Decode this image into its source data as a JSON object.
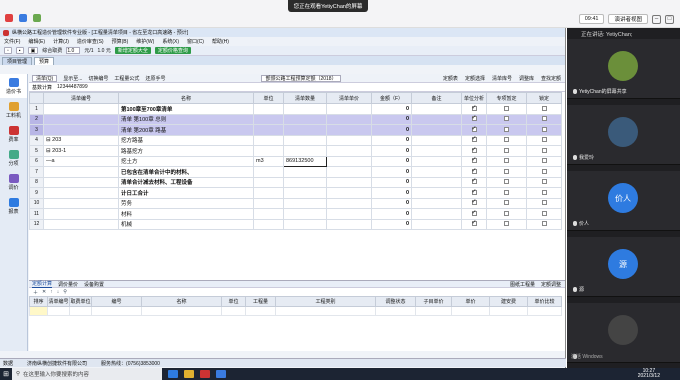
{
  "meeting": {
    "share_banner": "您正在观看YetiyChan的屏幕",
    "time": "09:41",
    "view_label": "演讲者视图"
  },
  "app": {
    "title": "纵横公路工程造价管理软件专业版 - [工程量清单项目 - 省左至龙口高速路 - 预计]",
    "menu": [
      "文件(F)",
      "编辑(E)",
      "计算(J)",
      "造价审查(S)",
      "预算(B)",
      "维护(W)",
      "系统(X)",
      "窗口(C)",
      "帮助(H)"
    ],
    "toolbar": {
      "rate_label": "综合取费",
      "rate_value": "1.0",
      "unit_price_label": "元/1",
      "price2_label": "1.0 元",
      "green_btn1": "新增定额大全",
      "green_btn2": "定额价格查询"
    },
    "project_tab": "项目管理",
    "project_subtab": "预算",
    "sidebar": [
      "造价书",
      "工料机",
      "费率",
      "分项",
      "调价",
      "报表"
    ],
    "filter": {
      "items": [
        "清单(Q)",
        "显示至...",
        "切换编号",
        "工程量公式",
        "还原手号"
      ],
      "standard": "部颁公路工程预算定额（2018）",
      "right_items": [
        "定额表",
        "定额选择",
        "清单库号",
        "调整库",
        "查找定额"
      ]
    },
    "input_bar": {
      "label": "基数计算",
      "value": "12344487899"
    },
    "grid": {
      "headers": [
        "",
        "清单编号",
        "名称",
        "单位",
        "清单数量",
        "清单单价",
        "金额（F）",
        "备注",
        "单位分析",
        "专项暂定",
        "锁定"
      ],
      "rows": [
        {
          "n": "1",
          "code": "",
          "name": "第100章至700章清单",
          "unit": "",
          "qty": "",
          "price": "",
          "amount": "0",
          "note": "",
          "sel": false,
          "bold": true,
          "chk1": true,
          "chk2": false,
          "chk3": false
        },
        {
          "n": "2",
          "code": "",
          "name": "清单  第100章  总则",
          "unit": "",
          "qty": "",
          "price": "",
          "amount": "0",
          "note": "",
          "sel": true,
          "bold": false,
          "chk1": true,
          "chk2": false,
          "chk3": false
        },
        {
          "n": "3",
          "code": "",
          "name": "清单  第200章  路基",
          "unit": "",
          "qty": "",
          "price": "",
          "amount": "0",
          "note": "",
          "sel": true,
          "bold": false,
          "chk1": true,
          "chk2": false,
          "chk3": false
        },
        {
          "n": "4",
          "code": "⊟ 203",
          "name": "挖方路基",
          "unit": "",
          "qty": "",
          "price": "",
          "amount": "0",
          "note": "",
          "sel": false,
          "bold": false,
          "chk1": true,
          "chk2": false,
          "chk3": false
        },
        {
          "n": "5",
          "code": "⊟ 203-1",
          "name": "路基挖方",
          "unit": "",
          "qty": "",
          "price": "",
          "amount": "0",
          "note": "",
          "sel": false,
          "bold": false,
          "chk1": true,
          "chk2": false,
          "chk3": false
        },
        {
          "n": "6",
          "code": "—a",
          "name": "挖土方",
          "unit": "m3",
          "qty": "869132500",
          "price": "",
          "amount": "0",
          "note": "",
          "sel": false,
          "bold": false,
          "chk1": true,
          "chk2": false,
          "chk3": false,
          "active": true
        },
        {
          "n": "7",
          "code": "",
          "name": "已包含在清单合计中的材料、",
          "unit": "",
          "qty": "",
          "price": "",
          "amount": "0",
          "note": "",
          "sel": false,
          "bold": true,
          "chk1": true,
          "chk2": false,
          "chk3": false
        },
        {
          "n": "8",
          "code": "",
          "name": "清单合计减去材料、工程设备",
          "unit": "",
          "qty": "",
          "price": "",
          "amount": "0",
          "note": "",
          "sel": false,
          "bold": true,
          "chk1": true,
          "chk2": false,
          "chk3": false
        },
        {
          "n": "9",
          "code": "",
          "name": "计日工合计",
          "unit": "",
          "qty": "",
          "price": "",
          "amount": "0",
          "note": "",
          "sel": false,
          "bold": true,
          "chk1": true,
          "chk2": false,
          "chk3": false
        },
        {
          "n": "10",
          "code": "",
          "name": "劳务",
          "unit": "",
          "qty": "",
          "price": "",
          "amount": "0",
          "note": "",
          "sel": false,
          "bold": false,
          "chk1": true,
          "chk2": false,
          "chk3": false
        },
        {
          "n": "11",
          "code": "",
          "name": "材料",
          "unit": "",
          "qty": "",
          "price": "",
          "amount": "0",
          "note": "",
          "sel": false,
          "bold": false,
          "chk1": true,
          "chk2": false,
          "chk3": false
        },
        {
          "n": "12",
          "code": "",
          "name": "机械",
          "unit": "",
          "qty": "",
          "price": "",
          "amount": "0",
          "note": "",
          "sel": false,
          "bold": false,
          "chk1": true,
          "chk2": false,
          "chk3": false
        }
      ]
    },
    "lower": {
      "tabs": [
        "定额计算",
        "调价量价",
        "设备购置"
      ],
      "right": [
        "图纸工程量",
        "定额调整"
      ],
      "headers": [
        "排序",
        "清单编号",
        "取费单位",
        "编号",
        "名称",
        "单位",
        "工程量",
        "工程类别",
        "调整状态",
        "子目单价",
        "单价",
        "建安费",
        "单价比较"
      ]
    },
    "status": [
      "数据",
      "济南纵横创捷软件有限公司",
      "服务热线：(0756)3853000"
    ]
  },
  "video": {
    "speaker_label": "正在讲话: YetiyChan;",
    "tiles": [
      {
        "name": "YetiyChan的屏幕共享",
        "color": "#6b8f3a",
        "initial": ""
      },
      {
        "name": "我爱玲",
        "color": "#3a5a7a",
        "initial": ""
      },
      {
        "name": "价人",
        "color": "#2e7be0",
        "initial": "价人"
      },
      {
        "name": "源",
        "color": "#2e7be0",
        "initial": "源"
      },
      {
        "name": "",
        "color": "#444",
        "initial": ""
      }
    ],
    "activate": "激活 Windows"
  },
  "taskbar": {
    "search_placeholder": "在这里输入你要搜索的内容",
    "time": "10:27",
    "date": "2021/3/12"
  }
}
